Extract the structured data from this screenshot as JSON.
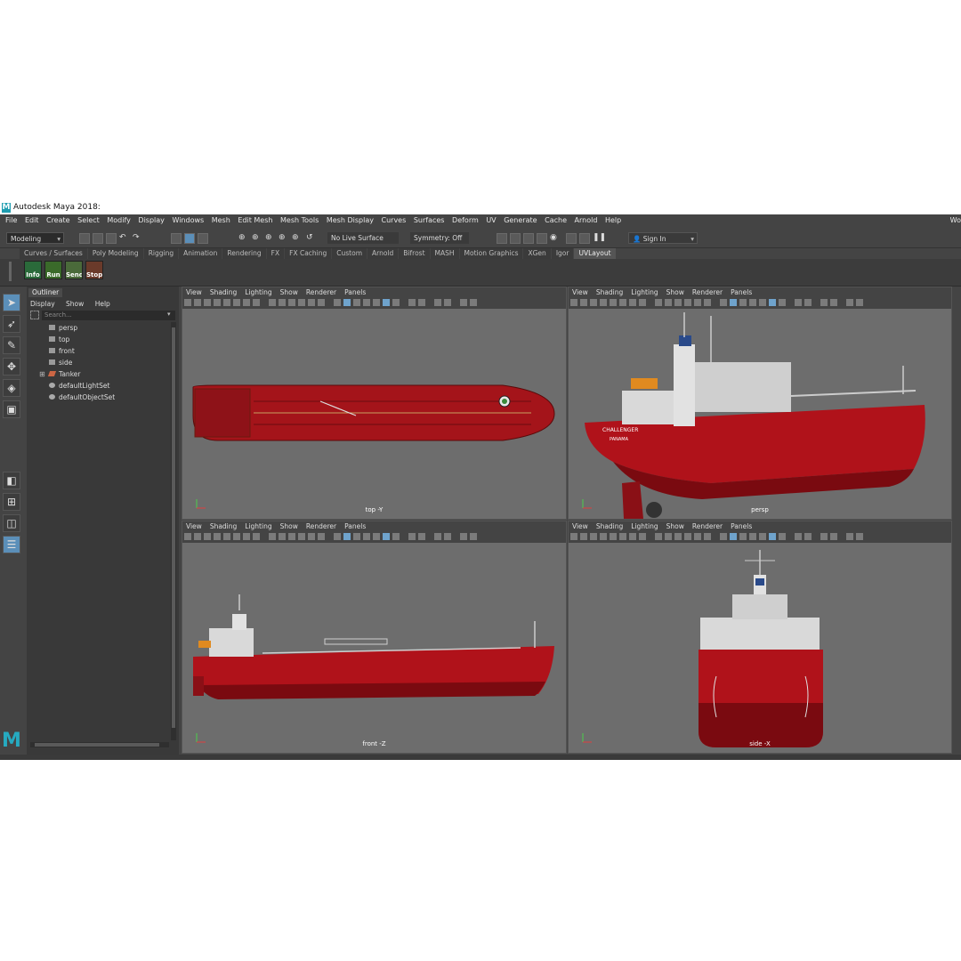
{
  "window": {
    "title": "Autodesk Maya 2018:"
  },
  "menubar": {
    "items": [
      "File",
      "Edit",
      "Create",
      "Select",
      "Modify",
      "Display",
      "Windows",
      "Mesh",
      "Edit Mesh",
      "Mesh Tools",
      "Mesh Display",
      "Curves",
      "Surfaces",
      "Deform",
      "UV",
      "Generate",
      "Cache",
      "Arnold",
      "Help"
    ],
    "workspace_label": "Wo"
  },
  "statusline": {
    "menuset": "Modeling",
    "live_surface": "No Live Surface",
    "symmetry": "Symmetry: Off",
    "sign_in": "Sign In"
  },
  "shelf": {
    "tabs": [
      "Curves / Surfaces",
      "Poly Modeling",
      "Rigging",
      "Animation",
      "Rendering",
      "FX",
      "FX Caching",
      "Custom",
      "Arnold",
      "Bifrost",
      "MASH",
      "Motion Graphics",
      "XGen",
      "Igor",
      "UVLayout"
    ],
    "active_tab": "UVLayout",
    "buttons": [
      "Info",
      "Run",
      "Send",
      "Stop"
    ]
  },
  "outliner": {
    "title": "Outliner",
    "menu": [
      "Display",
      "Show",
      "Help"
    ],
    "search_placeholder": "Search...",
    "items": [
      {
        "label": "persp",
        "icon": "camera-icon"
      },
      {
        "label": "top",
        "icon": "camera-icon"
      },
      {
        "label": "front",
        "icon": "camera-icon"
      },
      {
        "label": "side",
        "icon": "camera-icon"
      },
      {
        "label": "Tanker",
        "icon": "mesh-icon"
      },
      {
        "label": "defaultLightSet",
        "icon": "set-icon"
      },
      {
        "label": "defaultObjectSet",
        "icon": "set-icon"
      }
    ]
  },
  "viewports": {
    "menu": [
      "View",
      "Shading",
      "Lighting",
      "Show",
      "Renderer",
      "Panels"
    ],
    "top": {
      "label": "top -Y"
    },
    "persp": {
      "label": "persp"
    },
    "front": {
      "label": "front -Z"
    },
    "side": {
      "label": "side -X"
    }
  },
  "ship": {
    "name": "CHALLENGER",
    "port": "PANAMA",
    "hull_color": "#b0121a",
    "hull_dark": "#7a0a10",
    "superstructure_color": "#d9d9d9"
  },
  "colors": {
    "accent": "#5b8fb9",
    "logo": "#26aac0",
    "bg": "#444444"
  }
}
